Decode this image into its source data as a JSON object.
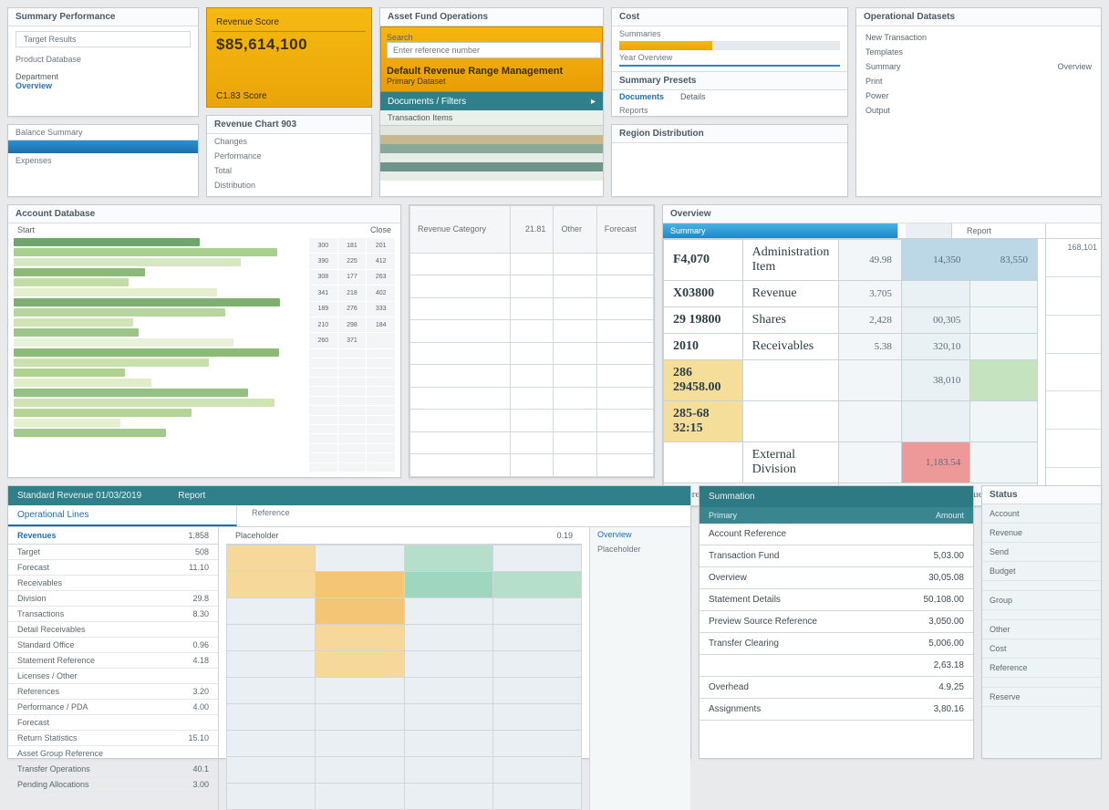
{
  "top": {
    "p1": {
      "title": "Summary Performance",
      "line1": "Target Results",
      "line2": "Product Database",
      "group": "Department",
      "opt": "Overview",
      "field": "Balance Summary",
      "note": "Expenses"
    },
    "p2": {
      "gold": {
        "title": "Revenue Score",
        "value": "$85,614,100",
        "foot": "C1.83 Score"
      },
      "card": {
        "title": "Revenue Chart 903",
        "l1": "Changes",
        "l2": "Performance",
        "l3": "Total",
        "l4": "Distribution"
      }
    },
    "p3": {
      "title": "Asset Fund Operations",
      "field": "Search",
      "ph": "Enter reference number",
      "band": "Default Revenue Range Management",
      "sub": "Primary Dataset",
      "bar": "Documents / Filters",
      "tab": "Transaction Items"
    },
    "p4": {
      "title": "Cost",
      "s1": "Summaries",
      "s2": "Year Overview",
      "box": "Summary Presets",
      "l1": "Documents",
      "l2": "Details",
      "l3": "Reports",
      "foot": "Region Distribution"
    },
    "p5": {
      "title": "Operational Datasets",
      "items": [
        "New Transaction",
        "Templates",
        "Summary",
        "Print",
        "Power",
        "Output"
      ],
      "val": "Overview"
    }
  },
  "mid": {
    "left": {
      "title": "Account Database",
      "cols": [
        "300",
        "181",
        "201",
        "390",
        "225",
        "412",
        "308",
        "177",
        "263",
        "341",
        "218",
        "402",
        "189",
        "276",
        "333",
        "210",
        "298",
        "184",
        "260",
        "371"
      ],
      "hA": "Start",
      "hB": "Close"
    },
    "center": {
      "h1": "Revenue Category",
      "v1": "21.81",
      "h2": "Other",
      "h3": "Forecast"
    },
    "right": {
      "title": "Overview",
      "tabs": [
        "Summary",
        "",
        "Report"
      ],
      "rows": [
        {
          "k": "F4,070",
          "d": "Administration Item",
          "a": "49.98",
          "b": "14,350",
          "c": "83,550"
        },
        {
          "k": "X03800",
          "d": "Revenue",
          "a": "3.705",
          "b": "",
          "c": ""
        },
        {
          "k": "29 19800",
          "d": "Shares",
          "a": "2,428",
          "b": "00,305",
          "c": ""
        },
        {
          "k": "2010",
          "d": "Receivables",
          "a": "5.38",
          "b": "320,10",
          "c": ""
        },
        {
          "k": "286 29458.00",
          "d": "",
          "a": "",
          "b": "38,010",
          "c": ""
        },
        {
          "k": "285-68 32:15",
          "d": "",
          "a": "",
          "b": "",
          "c": ""
        },
        {
          "k": "",
          "d": "External Division",
          "a": "",
          "b": "1,183.54",
          "c": ""
        }
      ],
      "foot": "Reference",
      "footR": "Revenue to Balance",
      "farCol": [
        "168,101",
        "",
        "",
        "",
        "",
        "",
        ""
      ]
    }
  },
  "bot": {
    "left": {
      "bar": "Standard Revenue 01/03/2019",
      "c1": "Report",
      "tab": "Operational Lines",
      "c2": "Reference",
      "hA": "Revenues",
      "hB": "Placeholder",
      "vA": "1,858",
      "vB": "0.19",
      "rows": [
        {
          "l": "Target",
          "v": "508"
        },
        {
          "l": "Forecast",
          "v": "11.10"
        },
        {
          "l": "Receivables",
          "v": ""
        },
        {
          "l": "Division",
          "v": "29.8"
        },
        {
          "l": "Transactions",
          "v": "8.30"
        },
        {
          "l": "Detail Receivables",
          "v": ""
        },
        {
          "l": "Standard Office",
          "v": "0.96"
        },
        {
          "l": "Statement Reference",
          "v": "4.18"
        },
        {
          "l": "Licenses / Other",
          "v": ""
        },
        {
          "l": "References",
          "v": "3.20"
        },
        {
          "l": "Performance / PDA",
          "v": "4.00"
        },
        {
          "l": "Forecast",
          "v": ""
        },
        {
          "l": "Return Statistics",
          "v": "15.10"
        },
        {
          "l": "Asset Group Reference",
          "v": ""
        },
        {
          "l": "Transfer Operations",
          "v": "40.1"
        },
        {
          "l": "Pending Allocations",
          "v": "3.00"
        }
      ],
      "sideA": "Overview",
      "sideB": "Placeholder"
    },
    "r1": {
      "title": "Summation",
      "h1": "Primary",
      "h2": "Amount",
      "rows": [
        [
          "Account Reference",
          ""
        ],
        [
          "Transaction Fund",
          "5,03.00"
        ],
        [
          "Overview",
          "30,05.08"
        ],
        [
          "Statement Details",
          "50,108.00"
        ],
        [
          "Preview Source Reference",
          "3,050.00"
        ],
        [
          "Transfer Clearing",
          "5,006.00"
        ],
        [
          "",
          "2,63.18"
        ],
        [
          "Overhead",
          "4.9.25"
        ],
        [
          "Assignments",
          "3,80.16"
        ]
      ]
    },
    "r2": {
      "title": "Status",
      "items": [
        "Account",
        "Revenue",
        "Send",
        "Budget",
        "",
        "Group",
        "",
        "Other",
        "Cost",
        "Reference",
        "",
        "Reserve"
      ]
    }
  }
}
